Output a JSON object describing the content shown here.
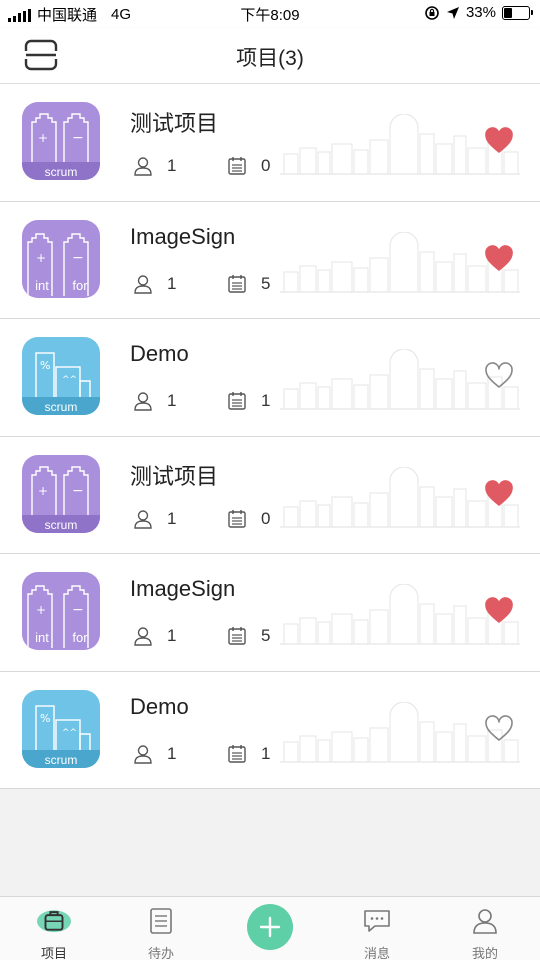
{
  "status_bar": {
    "carrier": "中国联通",
    "network": "4G",
    "time": "下午8:09",
    "battery": "33%",
    "battery_level": 0.33
  },
  "header": {
    "title": "项目(3)",
    "scan_icon": "scan-icon"
  },
  "projects": [
    {
      "name": "测试项目",
      "members": "1",
      "tasks": "0",
      "favorite": true,
      "icon": "scrum",
      "icon_color": "#a98fdc",
      "icon_band": "#8f73c8",
      "icon_label": "scrum"
    },
    {
      "name": "ImageSign",
      "members": "1",
      "tasks": "5",
      "favorite": true,
      "icon": "int-for",
      "icon_color": "#a98fdc",
      "icon_band": "#8f73c8",
      "icon_label_left": "int",
      "icon_label_right": "for"
    },
    {
      "name": "Demo",
      "members": "1",
      "tasks": "1",
      "favorite": false,
      "icon": "scrum-blue",
      "icon_color": "#6fc3e6",
      "icon_band": "#4aa6cc",
      "icon_label": "scrum"
    },
    {
      "name": "测试项目",
      "members": "1",
      "tasks": "0",
      "favorite": true,
      "icon": "scrum",
      "icon_color": "#a98fdc",
      "icon_band": "#8f73c8",
      "icon_label": "scrum"
    },
    {
      "name": "ImageSign",
      "members": "1",
      "tasks": "5",
      "favorite": true,
      "icon": "int-for",
      "icon_color": "#a98fdc",
      "icon_band": "#8f73c8",
      "icon_label_left": "int",
      "icon_label_right": "for"
    },
    {
      "name": "Demo",
      "members": "1",
      "tasks": "1",
      "favorite": false,
      "icon": "scrum-blue",
      "icon_color": "#6fc3e6",
      "icon_band": "#4aa6cc",
      "icon_label": "scrum"
    }
  ],
  "tab_bar": {
    "tabs": [
      {
        "label": "项目",
        "icon": "briefcase-icon",
        "active": true
      },
      {
        "label": "待办",
        "icon": "todo-list-icon",
        "active": false
      },
      {
        "label": "消息",
        "icon": "message-icon",
        "active": false
      },
      {
        "label": "我的",
        "icon": "profile-icon",
        "active": false
      }
    ],
    "add_icon": "plus-icon"
  },
  "colors": {
    "accent": "#5fcfa8",
    "favorite": "#e05a63",
    "favorite_off": "#888888"
  }
}
